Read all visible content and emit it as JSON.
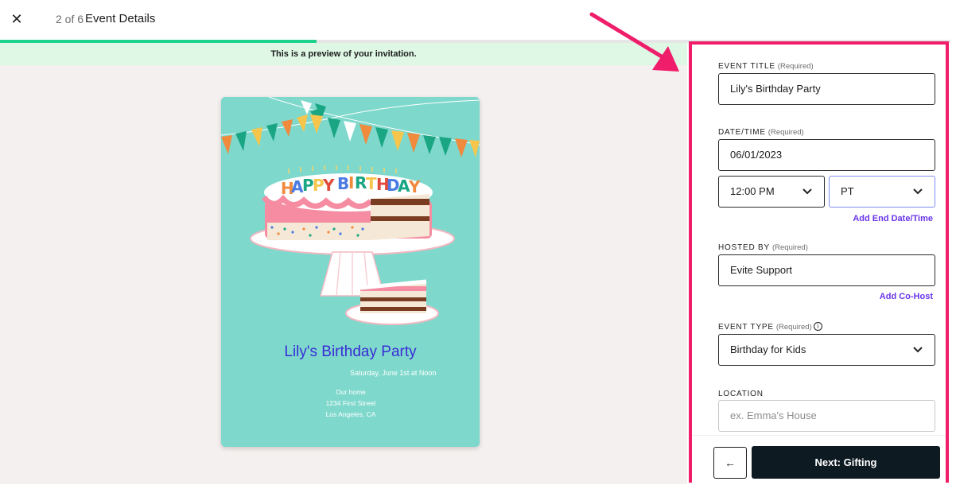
{
  "header": {
    "step": "2 of 6",
    "title": "Event Details",
    "close_icon": "close-x-icon"
  },
  "progress": {
    "fraction": 0.333
  },
  "preview": {
    "banner": "This is a preview of your invitation.",
    "card": {
      "cake_letters": [
        "H",
        "A",
        "P",
        "P",
        "Y",
        "B",
        "I",
        "R",
        "T",
        "H",
        "D",
        "A",
        "Y"
      ],
      "title": "Lily's Birthday Party",
      "date": "Saturday, June 1st at Noon",
      "address": [
        "Our home",
        "1234 First Street",
        "Los Angeles, CA"
      ]
    }
  },
  "form": {
    "event_title": {
      "label": "EVENT TITLE",
      "required": "(Required)",
      "value": "Lily's Birthday Party"
    },
    "date_time": {
      "label": "DATE/TIME",
      "required": "(Required)",
      "date": "06/01/2023",
      "time": "12:00 PM",
      "timezone": "PT",
      "add_end_link": "Add End Date/Time"
    },
    "hosted_by": {
      "label": "HOSTED BY",
      "required": "(Required)",
      "value": "Evite Support",
      "add_cohost_link": "Add Co-Host"
    },
    "event_type": {
      "label": "EVENT TYPE",
      "required": "(Required)",
      "info_icon": "info-circle-icon",
      "value": "Birthday for Kids"
    },
    "location": {
      "label": "LOCATION",
      "placeholder": "ex. Emma's House"
    }
  },
  "footer": {
    "back_icon": "arrow-left-icon",
    "next_label": "Next: Gifting"
  },
  "colors": {
    "accent": "#1ed28d",
    "highlight_border": "#ef1d6a",
    "link": "#6935e9",
    "primary_button": "#0d1a22",
    "card_bg": "#7ed8cc"
  }
}
